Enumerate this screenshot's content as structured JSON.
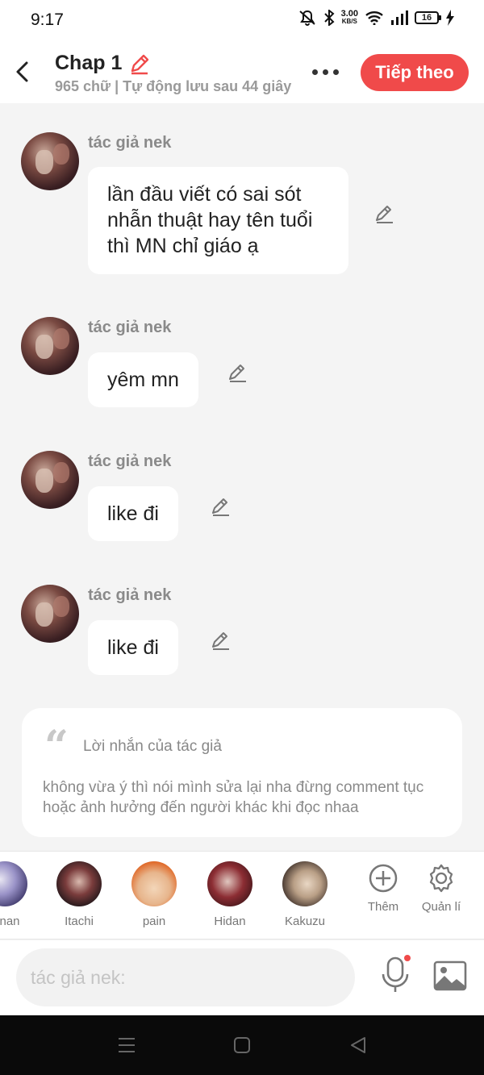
{
  "status_bar": {
    "time": "9:17",
    "network_speed_value": "3.00",
    "network_speed_unit": "KB/S",
    "battery": "16"
  },
  "header": {
    "title": "Chap 1",
    "subtitle": "965 chữ | Tự động lưu sau 44 giây",
    "next_button": "Tiếp theo"
  },
  "messages": [
    {
      "author": "tác giả nek",
      "text": "lần đầu viết có sai sót nhẫn thuật hay tên tuổi thì MN chỉ giáo ạ"
    },
    {
      "author": "tác giả nek",
      "text": "yêm mn"
    },
    {
      "author": "tác giả nek",
      "text": "like đi"
    },
    {
      "author": "tác giả nek",
      "text": "like đi"
    }
  ],
  "author_note": {
    "label": "Lời nhắn của tác giả",
    "text": "không vừa ý thì nói mình sửa lại nha đừng comment tục hoặc ảnh hưởng đến người khác khi đọc nhaa"
  },
  "characters": [
    {
      "name": "nan"
    },
    {
      "name": "Itachi"
    },
    {
      "name": "pain"
    },
    {
      "name": "Hidan"
    },
    {
      "name": "Kakuzu"
    }
  ],
  "tools": {
    "add_label": "Thêm",
    "manage_label": "Quản lí"
  },
  "input": {
    "placeholder": "tác giả nek:"
  },
  "colors": {
    "accent": "#f04a4a",
    "background": "#f4f4f4"
  }
}
